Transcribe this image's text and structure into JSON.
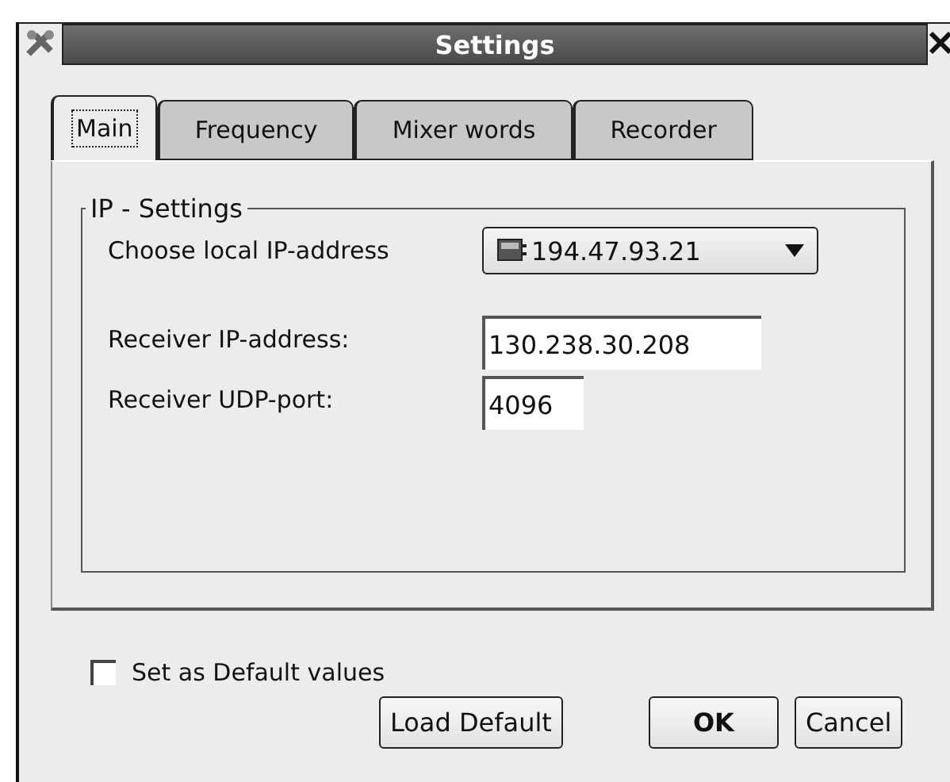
{
  "window": {
    "title": "Settings"
  },
  "tabs": [
    {
      "label": "Main",
      "selected": true
    },
    {
      "label": "Frequency",
      "selected": false
    },
    {
      "label": "Mixer words",
      "selected": false
    },
    {
      "label": "Recorder",
      "selected": false
    }
  ],
  "group": {
    "title": "IP - Settings",
    "fields": [
      {
        "kind": "dropdown",
        "label": "Choose local IP-address",
        "value": "194.47.93.21"
      },
      {
        "kind": "text",
        "label": "Receiver IP-address:",
        "value": "130.238.30.208"
      },
      {
        "kind": "text",
        "label": "Receiver UDP-port:",
        "value": "4096"
      }
    ]
  },
  "default_checkbox": {
    "label": "Set as Default values",
    "checked": false
  },
  "buttons": [
    {
      "label": "Load Default",
      "kind": "plain"
    },
    {
      "label": "OK",
      "kind": "default"
    },
    {
      "label": "Cancel",
      "kind": "plain"
    }
  ]
}
